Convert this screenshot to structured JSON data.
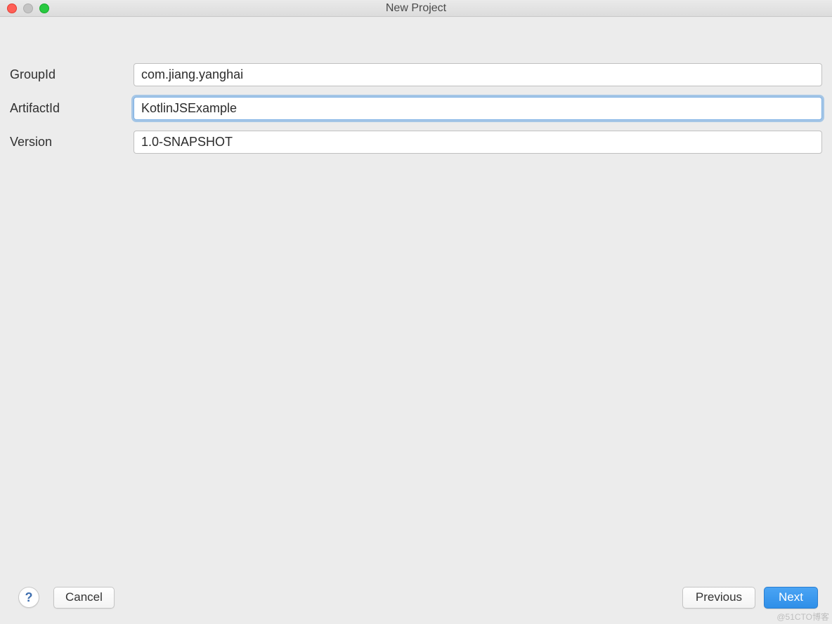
{
  "window": {
    "title": "New Project"
  },
  "form": {
    "group_id": {
      "label": "GroupId",
      "value": "com.jiang.yanghai"
    },
    "artifact_id": {
      "label": "ArtifactId",
      "value": "KotlinJSExample"
    },
    "version": {
      "label": "Version",
      "value": "1.0-SNAPSHOT"
    }
  },
  "footer": {
    "help_symbol": "?",
    "cancel": "Cancel",
    "previous": "Previous",
    "next": "Next"
  },
  "watermark": "@51CTO博客"
}
